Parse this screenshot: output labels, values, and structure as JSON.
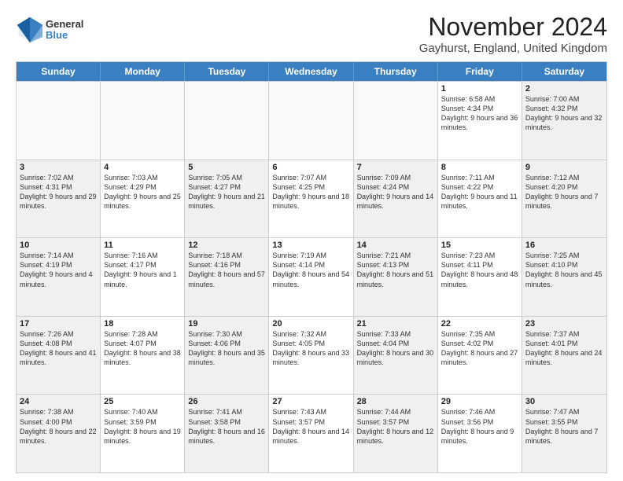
{
  "header": {
    "logo": {
      "general": "General",
      "blue": "Blue"
    },
    "title": "November 2024",
    "location": "Gayhurst, England, United Kingdom"
  },
  "calendar": {
    "days_of_week": [
      "Sunday",
      "Monday",
      "Tuesday",
      "Wednesday",
      "Thursday",
      "Friday",
      "Saturday"
    ],
    "weeks": [
      [
        {
          "day": "",
          "info": "",
          "empty": true
        },
        {
          "day": "",
          "info": "",
          "empty": true
        },
        {
          "day": "",
          "info": "",
          "empty": true
        },
        {
          "day": "",
          "info": "",
          "empty": true
        },
        {
          "day": "",
          "info": "",
          "empty": true
        },
        {
          "day": "1",
          "info": "Sunrise: 6:58 AM\nSunset: 4:34 PM\nDaylight: 9 hours and 36 minutes."
        },
        {
          "day": "2",
          "info": "Sunrise: 7:00 AM\nSunset: 4:32 PM\nDaylight: 9 hours and 32 minutes.",
          "shaded": true
        }
      ],
      [
        {
          "day": "3",
          "info": "Sunrise: 7:02 AM\nSunset: 4:31 PM\nDaylight: 9 hours and 29 minutes.",
          "shaded": true
        },
        {
          "day": "4",
          "info": "Sunrise: 7:03 AM\nSunset: 4:29 PM\nDaylight: 9 hours and 25 minutes."
        },
        {
          "day": "5",
          "info": "Sunrise: 7:05 AM\nSunset: 4:27 PM\nDaylight: 9 hours and 21 minutes.",
          "shaded": true
        },
        {
          "day": "6",
          "info": "Sunrise: 7:07 AM\nSunset: 4:25 PM\nDaylight: 9 hours and 18 minutes."
        },
        {
          "day": "7",
          "info": "Sunrise: 7:09 AM\nSunset: 4:24 PM\nDaylight: 9 hours and 14 minutes.",
          "shaded": true
        },
        {
          "day": "8",
          "info": "Sunrise: 7:11 AM\nSunset: 4:22 PM\nDaylight: 9 hours and 11 minutes."
        },
        {
          "day": "9",
          "info": "Sunrise: 7:12 AM\nSunset: 4:20 PM\nDaylight: 9 hours and 7 minutes.",
          "shaded": true
        }
      ],
      [
        {
          "day": "10",
          "info": "Sunrise: 7:14 AM\nSunset: 4:19 PM\nDaylight: 9 hours and 4 minutes.",
          "shaded": true
        },
        {
          "day": "11",
          "info": "Sunrise: 7:16 AM\nSunset: 4:17 PM\nDaylight: 9 hours and 1 minute."
        },
        {
          "day": "12",
          "info": "Sunrise: 7:18 AM\nSunset: 4:16 PM\nDaylight: 8 hours and 57 minutes.",
          "shaded": true
        },
        {
          "day": "13",
          "info": "Sunrise: 7:19 AM\nSunset: 4:14 PM\nDaylight: 8 hours and 54 minutes."
        },
        {
          "day": "14",
          "info": "Sunrise: 7:21 AM\nSunset: 4:13 PM\nDaylight: 8 hours and 51 minutes.",
          "shaded": true
        },
        {
          "day": "15",
          "info": "Sunrise: 7:23 AM\nSunset: 4:11 PM\nDaylight: 8 hours and 48 minutes."
        },
        {
          "day": "16",
          "info": "Sunrise: 7:25 AM\nSunset: 4:10 PM\nDaylight: 8 hours and 45 minutes.",
          "shaded": true
        }
      ],
      [
        {
          "day": "17",
          "info": "Sunrise: 7:26 AM\nSunset: 4:08 PM\nDaylight: 8 hours and 41 minutes.",
          "shaded": true
        },
        {
          "day": "18",
          "info": "Sunrise: 7:28 AM\nSunset: 4:07 PM\nDaylight: 8 hours and 38 minutes."
        },
        {
          "day": "19",
          "info": "Sunrise: 7:30 AM\nSunset: 4:06 PM\nDaylight: 8 hours and 35 minutes.",
          "shaded": true
        },
        {
          "day": "20",
          "info": "Sunrise: 7:32 AM\nSunset: 4:05 PM\nDaylight: 8 hours and 33 minutes."
        },
        {
          "day": "21",
          "info": "Sunrise: 7:33 AM\nSunset: 4:04 PM\nDaylight: 8 hours and 30 minutes.",
          "shaded": true
        },
        {
          "day": "22",
          "info": "Sunrise: 7:35 AM\nSunset: 4:02 PM\nDaylight: 8 hours and 27 minutes."
        },
        {
          "day": "23",
          "info": "Sunrise: 7:37 AM\nSunset: 4:01 PM\nDaylight: 8 hours and 24 minutes.",
          "shaded": true
        }
      ],
      [
        {
          "day": "24",
          "info": "Sunrise: 7:38 AM\nSunset: 4:00 PM\nDaylight: 8 hours and 22 minutes.",
          "shaded": true
        },
        {
          "day": "25",
          "info": "Sunrise: 7:40 AM\nSunset: 3:59 PM\nDaylight: 8 hours and 19 minutes."
        },
        {
          "day": "26",
          "info": "Sunrise: 7:41 AM\nSunset: 3:58 PM\nDaylight: 8 hours and 16 minutes.",
          "shaded": true
        },
        {
          "day": "27",
          "info": "Sunrise: 7:43 AM\nSunset: 3:57 PM\nDaylight: 8 hours and 14 minutes."
        },
        {
          "day": "28",
          "info": "Sunrise: 7:44 AM\nSunset: 3:57 PM\nDaylight: 8 hours and 12 minutes.",
          "shaded": true
        },
        {
          "day": "29",
          "info": "Sunrise: 7:46 AM\nSunset: 3:56 PM\nDaylight: 8 hours and 9 minutes."
        },
        {
          "day": "30",
          "info": "Sunrise: 7:47 AM\nSunset: 3:55 PM\nDaylight: 8 hours and 7 minutes.",
          "shaded": true
        }
      ]
    ]
  }
}
